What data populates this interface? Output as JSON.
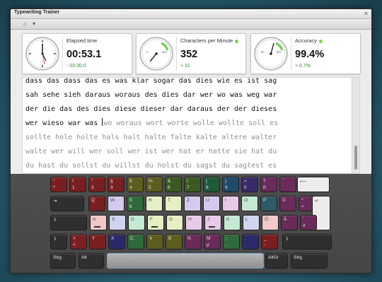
{
  "window": {
    "title": "Typewriting Trainer",
    "close_glyph": "×"
  },
  "toolbar": [
    {
      "name": "home-icon",
      "glyph": "⌂"
    },
    {
      "name": "settings-icon",
      "glyph": "▾"
    }
  ],
  "stats": {
    "elapsed": {
      "label": "Elapsed time",
      "value": "00:53.1",
      "ref": "- 03:30.0",
      "gauge_icon": "clock-icon"
    },
    "cpm": {
      "label": "Characters per Minute",
      "value": "352",
      "ref": "+ 31",
      "gauge_icon": "speedometer-icon",
      "gauge_ticks": [
        "0",
        "300"
      ]
    },
    "accuracy": {
      "label": "Accuracy",
      "value": "99.4%",
      "ref": "+ 0.7%",
      "gauge_icon": "accuracy-gauge-icon",
      "gauge_ticks": [
        "90",
        "100"
      ]
    }
  },
  "text_lines": [
    {
      "typed": "dass das dass das es was klar sogar das dies wie es ist sag",
      "pending": ""
    },
    {
      "typed": "sah sehe sieh daraus woraus des dies dar wer wo was weg war",
      "pending": ""
    },
    {
      "typed": "der die das des dies diese dieser dar daraus der der dieses",
      "pending": ""
    },
    {
      "typed": "wer wieso war was ",
      "pending": "wo woraus wort worte wolle wollte soll es",
      "cursor": true
    },
    {
      "typed": "",
      "pending": "sollte hole holte hals halt halte falte kalte altere walter"
    },
    {
      "typed": "",
      "pending": "walte wer will wer soll wer ist wer hat er hatte sie hat du"
    },
    {
      "typed": "",
      "pending": "du hast du sollst du willst du holst du sagst du sagtest es"
    }
  ],
  "keyboard": {
    "rows": [
      [
        {
          "top": "°",
          "bottom": "^",
          "color": "#7a1f1f"
        },
        {
          "top": "!",
          "bottom": "1",
          "color": "#7a1f1f"
        },
        {
          "top": "\"",
          "bottom": "2",
          "color": "#7a1f1f"
        },
        {
          "top": "§",
          "bottom": "3",
          "color": "#7a1f1f"
        },
        {
          "top": "$",
          "bottom": "4",
          "color": "#5c5c1f"
        },
        {
          "top": "%",
          "bottom": "5",
          "color": "#5c5c1f"
        },
        {
          "top": "&",
          "bottom": "6",
          "color": "#3b5a1f"
        },
        {
          "top": "/",
          "bottom": "7",
          "color": "#3b5a1f"
        },
        {
          "top": "(",
          "bottom": "8",
          "color": "#1f5a3b"
        },
        {
          "top": ")",
          "bottom": "9",
          "color": "#1f4a6a"
        },
        {
          "top": "=",
          "bottom": "0",
          "color": "#3a2a6a"
        },
        {
          "top": "?",
          "bottom": "ß",
          "color": "#6a2a5a"
        },
        {
          "top": "`",
          "bottom": "´",
          "color": "#6a2a5a"
        },
        {
          "top": "",
          "bottom": "",
          "color": "#7a1f1f"
        },
        {
          "top": "⟵",
          "bottom": "",
          "color": "#ececec",
          "light": true,
          "name": "backspace-key"
        }
      ],
      [
        {
          "top": "⇥",
          "bottom": "",
          "color": "#2f2f2f",
          "name": "tab-key"
        },
        {
          "top": "Q",
          "bottom": "",
          "color": "#7a1f1f"
        },
        {
          "top": "W",
          "bottom": "",
          "color": "#d6c9ee",
          "light": true
        },
        {
          "top": "E",
          "bottom": "€",
          "color": "#2f6a3a"
        },
        {
          "top": "R",
          "bottom": "",
          "color": "#e6eec4",
          "light": true
        },
        {
          "top": "T",
          "bottom": "",
          "color": "#e6eec4",
          "light": true
        },
        {
          "top": "Z",
          "bottom": "",
          "color": "#d6c9ee",
          "light": true
        },
        {
          "top": "U",
          "bottom": "",
          "color": "#d6c9ee",
          "light": true
        },
        {
          "top": "I",
          "bottom": "",
          "color": "#e8c9e8",
          "light": true
        },
        {
          "top": "O",
          "bottom": "",
          "color": "#c4ead2",
          "light": true
        },
        {
          "top": "P",
          "bottom": "",
          "color": "#2f5a6a"
        },
        {
          "top": "Ü",
          "bottom": "",
          "color": "#6a2a5a"
        },
        {
          "top": "*",
          "bottom": "+",
          "color": "#6a2a5a"
        },
        {
          "top": "↵",
          "bottom": "",
          "color": "#ececec",
          "light": true,
          "name": "enter-key"
        }
      ],
      [
        {
          "top": "⇩",
          "bottom": "",
          "color": "#2f2f2f",
          "name": "caps-lock-key"
        },
        {
          "top": "A",
          "bottom": "",
          "color": "#f2c8c8",
          "light": true,
          "home": true
        },
        {
          "top": "S",
          "bottom": "",
          "color": "#cfd5ee",
          "light": true
        },
        {
          "top": "D",
          "bottom": "",
          "color": "#c4ead2",
          "light": true
        },
        {
          "top": "F",
          "bottom": "",
          "color": "#e6eec4",
          "light": true,
          "home": true
        },
        {
          "top": "G",
          "bottom": "",
          "color": "#e6eec4",
          "light": true
        },
        {
          "top": "H",
          "bottom": "",
          "color": "#e8c9e8",
          "light": true
        },
        {
          "top": "J",
          "bottom": "",
          "color": "#e8c9e8",
          "light": true,
          "home": true
        },
        {
          "top": "K",
          "bottom": "",
          "color": "#c4ead2",
          "light": true
        },
        {
          "top": "L",
          "bottom": "",
          "color": "#cfd5ee",
          "light": true
        },
        {
          "top": "Ö",
          "bottom": "",
          "color": "#f2c8c8",
          "light": true
        },
        {
          "top": "Ä",
          "bottom": "",
          "color": "#6a2a5a"
        },
        {
          "top": "'",
          "bottom": "#",
          "color": "#6a2a5a"
        }
      ],
      [
        {
          "top": "⇧",
          "bottom": "",
          "color": "#2f2f2f",
          "name": "left-shift-key"
        },
        {
          "top": ">",
          "bottom": "<",
          "color": "#7a1f1f"
        },
        {
          "top": "Y",
          "bottom": "",
          "color": "#7a1f1f"
        },
        {
          "top": "X",
          "bottom": "",
          "color": "#2a2a6a"
        },
        {
          "top": "C",
          "bottom": "",
          "color": "#2f6a3a"
        },
        {
          "top": "V",
          "bottom": "",
          "color": "#5c5c1f"
        },
        {
          "top": "B",
          "bottom": "",
          "color": "#5c5c1f"
        },
        {
          "top": "N",
          "bottom": "",
          "color": "#6a2a5a"
        },
        {
          "top": "M",
          "bottom": "µ",
          "color": "#6a2a5a"
        },
        {
          "top": ";",
          "bottom": ",",
          "color": "#2f6a3a"
        },
        {
          "top": ":",
          "bottom": ".",
          "color": "#2a2a6a"
        },
        {
          "top": "_",
          "bottom": "-",
          "color": "#7a1f1f"
        },
        {
          "top": "⇧",
          "bottom": "",
          "color": "#2f2f2f",
          "name": "right-shift-key"
        }
      ],
      [
        {
          "top": "Strg",
          "bottom": "",
          "color": "#2f2f2f",
          "name": "left-ctrl-key"
        },
        {
          "top": "Alt",
          "bottom": "",
          "color": "#2f2f2f",
          "name": "alt-key"
        },
        {
          "top": "",
          "bottom": "",
          "color": "#9a9a9a",
          "name": "space-key"
        },
        {
          "top": "AltGr",
          "bottom": "",
          "color": "#2f2f2f",
          "name": "altgr-key"
        },
        {
          "top": "Strg",
          "bottom": "",
          "color": "#2f2f2f",
          "name": "right-ctrl-key"
        }
      ]
    ]
  }
}
